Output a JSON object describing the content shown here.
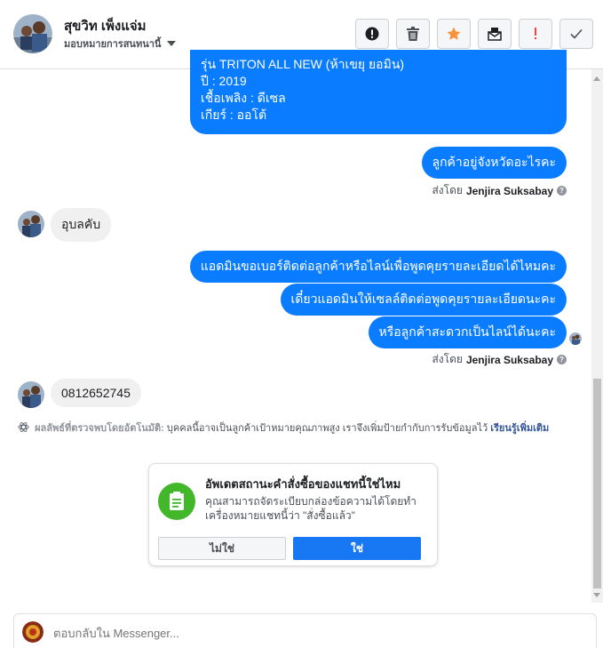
{
  "header": {
    "name": "สุขวิท เพ็งแจ่ม",
    "assign_label": "มอบหมายการสนทนานี้"
  },
  "toolbar": {
    "buttons": [
      "alert-icon",
      "trash-icon",
      "star-icon",
      "mark-unread-icon",
      "important-icon",
      "done-icon"
    ]
  },
  "messages": {
    "outgoing_top": {
      "line_cut": "รุ่น TRITON ALL NEW (ห้าเขยุ ยอมิน)",
      "line_year": "ปี : 2019",
      "line_fuel": "เชื้อเพลิง : ดีเซล",
      "line_gear": "เกียร์ : ออโต้"
    },
    "outgoing_province": "ลูกค้าอยู่จังหวัดอะไรคะ",
    "sent_by_1": {
      "prefix": "ส่งโดย",
      "name": "Jenjira Suksabay"
    },
    "incoming_1": "อุบลคับ",
    "outgoing_2a": "แอดมินขอเบอร์ติดต่อลูกค้าหรือไลน์เพื่อพูดคุยรายละเอียดได้ไหมคะ",
    "outgoing_2b": "เดี๋ยวแอดมินให้เซลล์ติดต่อพูดคุยรายละเอียดนะคะ",
    "outgoing_2c": "หรือลูกค้าสะดวกเป็นไลน์ได้นะคะ",
    "sent_by_2": {
      "prefix": "ส่งโดย",
      "name": "Jenjira Suksabay"
    },
    "incoming_2": "0812652745"
  },
  "auto_detect": {
    "label": "ผลลัพธ์ที่ตรวจพบโดยอัตโนมัติ:",
    "text": "บุคคลนี้อาจเป็นลูกค้าเป้าหมายคุณภาพสูง เราจึงเพิ่มป้ายกำกับการรับข้อมูลไว้",
    "link": "เรียนรู้เพิ่มเติม"
  },
  "card": {
    "title": "อัพเดตสถานะคำสั่งซื้อของแชทนี้ใช่ไหม",
    "body": "คุณสามารถจัดระเบียบกล่องข้อความได้โดยทำเครื่องหมายแชทนี้ว่า \"สั่งซื้อแล้ว\"",
    "no_label": "ไม่ใช่",
    "yes_label": "ใช่"
  },
  "composer": {
    "placeholder": "ตอบกลับใน Messenger..."
  },
  "colors": {
    "outgoing_bubble": "#0a7cff",
    "incoming_bubble": "#f1f0f0",
    "accent": "#1877f2",
    "star": "#f7923b",
    "important": "#fa3e3e",
    "card_icon": "#42b72a"
  }
}
